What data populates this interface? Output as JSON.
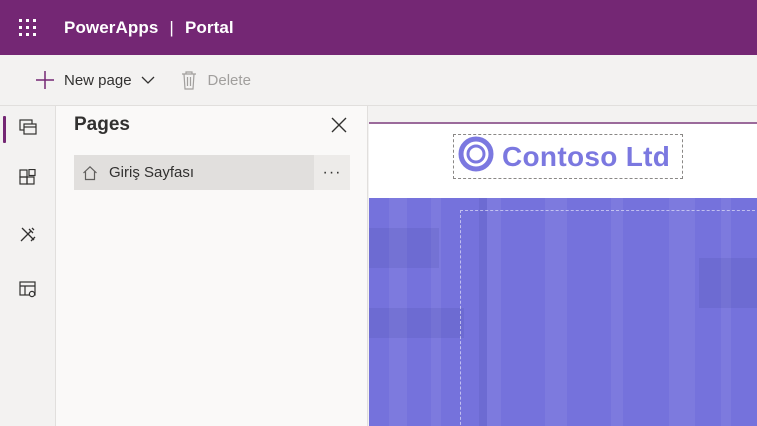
{
  "header": {
    "app_name": "PowerApps",
    "separator": "|",
    "section": "Portal"
  },
  "commands": {
    "new_page": "New page",
    "delete": "Delete"
  },
  "rail": {
    "items": [
      "pages-icon",
      "components-icon",
      "themes-icon",
      "settings-icon"
    ]
  },
  "panel": {
    "title": "Pages",
    "pages": [
      {
        "label": "Giriş Sayfası",
        "more": "···"
      }
    ]
  },
  "site": {
    "logo_text": "Contoso Ltd"
  },
  "colors": {
    "brand": "#742774",
    "logo": "#7b78e0",
    "hero": "#7572dc"
  }
}
